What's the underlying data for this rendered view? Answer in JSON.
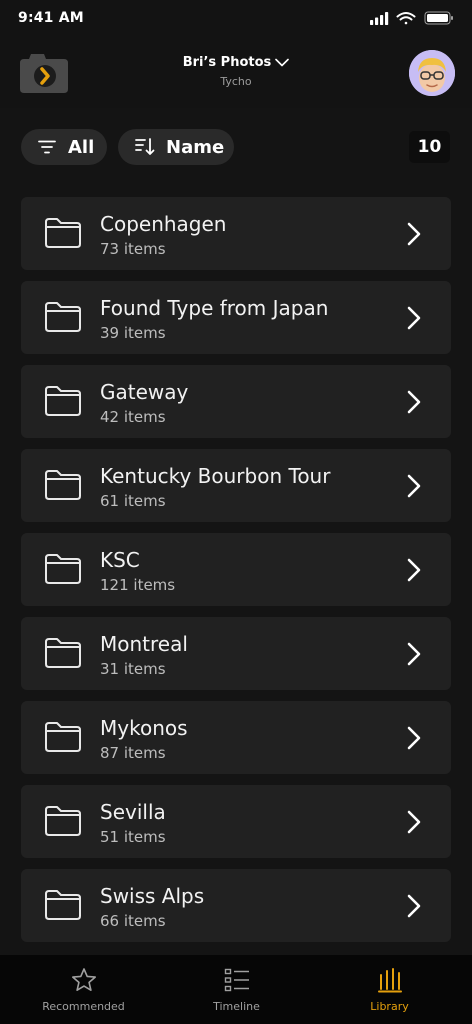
{
  "status_bar": {
    "time": "9:41 AM"
  },
  "header": {
    "title": "Bri’s Photos",
    "subtitle": "Tycho"
  },
  "toolbar": {
    "filter_label": "All",
    "sort_label": "Name",
    "item_count": "10"
  },
  "folders": [
    {
      "name": "Copenhagen",
      "count": "73 items"
    },
    {
      "name": "Found Type from Japan",
      "count": "39 items"
    },
    {
      "name": "Gateway",
      "count": "42 items"
    },
    {
      "name": "Kentucky Bourbon Tour",
      "count": "61 items"
    },
    {
      "name": "KSC",
      "count": "121 items"
    },
    {
      "name": "Montreal",
      "count": "31 items"
    },
    {
      "name": "Mykonos",
      "count": "87 items"
    },
    {
      "name": "Sevilla",
      "count": "51 items"
    },
    {
      "name": "Swiss Alps",
      "count": "66 items"
    }
  ],
  "tabs": [
    {
      "label": "Recommended",
      "icon": "star-icon"
    },
    {
      "label": "Timeline",
      "icon": "list-icon"
    },
    {
      "label": "Library",
      "icon": "library-icon",
      "active": true
    }
  ],
  "colors": {
    "accent": "#e5a00d",
    "background": "#141414",
    "card": "#212121",
    "button": "#2a2a2a"
  }
}
